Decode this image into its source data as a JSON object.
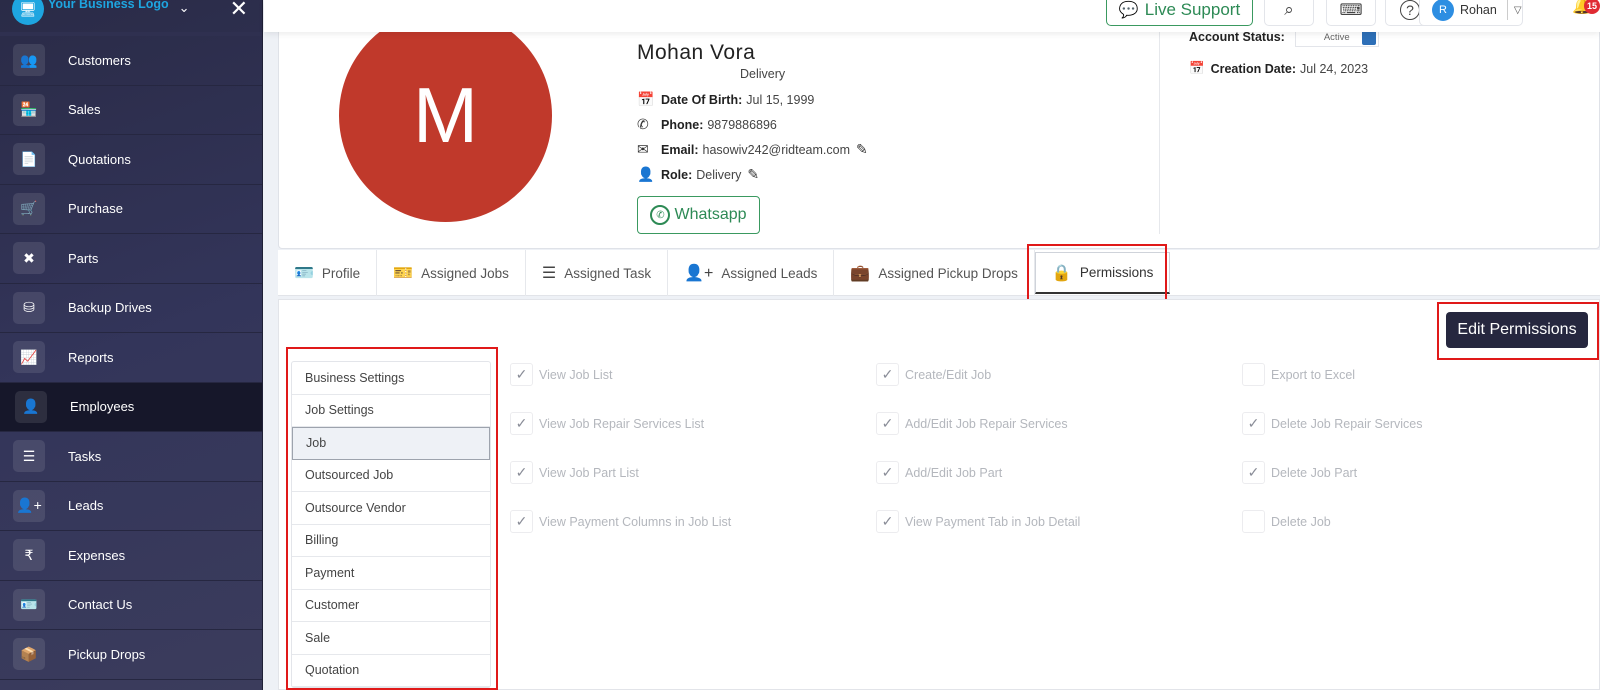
{
  "sidebar": {
    "logo_text": "Your Business Logo",
    "items": [
      {
        "label": "Customers",
        "icon": "users-icon",
        "glyph": "👥"
      },
      {
        "label": "Sales",
        "icon": "store-icon",
        "glyph": "🏪"
      },
      {
        "label": "Quotations",
        "icon": "document-icon",
        "glyph": "📄"
      },
      {
        "label": "Purchase",
        "icon": "cart-icon",
        "glyph": "🛒"
      },
      {
        "label": "Parts",
        "icon": "tools-icon",
        "glyph": "✖"
      },
      {
        "label": "Backup Drives",
        "icon": "database-icon",
        "glyph": "⛁"
      },
      {
        "label": "Reports",
        "icon": "chart-icon",
        "glyph": "📈"
      },
      {
        "label": "Employees",
        "icon": "employee-icon",
        "glyph": "👤",
        "active": true
      },
      {
        "label": "Tasks",
        "icon": "tasks-icon",
        "glyph": "☰"
      },
      {
        "label": "Leads",
        "icon": "add-user-icon",
        "glyph": "👤+"
      },
      {
        "label": "Expenses",
        "icon": "rupee-icon",
        "glyph": "₹"
      },
      {
        "label": "Contact Us",
        "icon": "contact-card-icon",
        "glyph": "🪪"
      },
      {
        "label": "Pickup Drops",
        "icon": "pickup-icon",
        "glyph": "📦"
      }
    ]
  },
  "topbar": {
    "live_support": "Live Support",
    "user_initial": "R",
    "user_name": "Rohan",
    "notification_count": "15"
  },
  "profile": {
    "initial": "M",
    "name": "Mohan Vora",
    "role_subtitle": "Delivery",
    "dob_label": "Date Of Birth:",
    "dob": "Jul 15, 1999",
    "phone_label": "Phone:",
    "phone": "9879886896",
    "email_label": "Email:",
    "email": "hasowiv242@ridteam.com",
    "role_label": "Role:",
    "role": "Delivery",
    "whatsapp": "Whatsapp",
    "account_status_label": "Account Status:",
    "account_status": "Active",
    "creation_label": "Creation Date:",
    "creation_date": "Jul 24, 2023"
  },
  "tabs": [
    {
      "label": "Profile",
      "glyph": "🪪"
    },
    {
      "label": "Assigned Jobs",
      "glyph": "🎫"
    },
    {
      "label": "Assigned Task",
      "glyph": "☰"
    },
    {
      "label": "Assigned Leads",
      "glyph": "👤+"
    },
    {
      "label": "Assigned Pickup Drops",
      "glyph": "💼"
    },
    {
      "label": "Permissions",
      "glyph": "🔒",
      "active": true
    }
  ],
  "permissions": {
    "edit_button": "Edit Permissions",
    "categories": [
      "Business Settings",
      "Job Settings",
      "Job",
      "Outsourced Job",
      "Outsource Vendor",
      "Billing",
      "Payment",
      "Customer",
      "Sale",
      "Quotation"
    ],
    "selected_category": "Job",
    "items": [
      {
        "label": "View Job List",
        "checked": true
      },
      {
        "label": "Create/Edit Job",
        "checked": true
      },
      {
        "label": "Export to Excel",
        "checked": false
      },
      {
        "label": "View Job Repair Services List",
        "checked": true
      },
      {
        "label": "Add/Edit Job Repair Services",
        "checked": true
      },
      {
        "label": "Delete Job Repair Services",
        "checked": true
      },
      {
        "label": "View Job Part List",
        "checked": true
      },
      {
        "label": "Add/Edit Job Part",
        "checked": true
      },
      {
        "label": "Delete Job Part",
        "checked": true
      },
      {
        "label": "View Payment Columns in Job List",
        "checked": true
      },
      {
        "label": "View Payment Tab in Job Detail",
        "checked": true
      },
      {
        "label": "Delete Job",
        "checked": false
      }
    ]
  }
}
